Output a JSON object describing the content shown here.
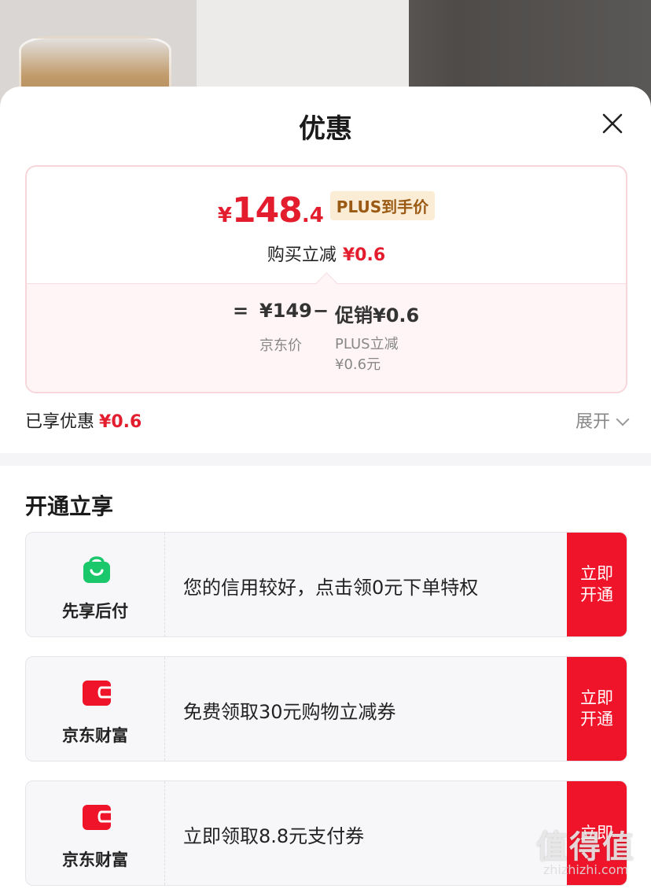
{
  "sheet": {
    "title": "优惠"
  },
  "price_card": {
    "currency": "¥",
    "price_int": "148",
    "price_dec": ".4",
    "plus_tag": "PLUS到手价",
    "save_label": "购买立减",
    "save_value": "¥0.6",
    "formula": {
      "eq": "=",
      "jd_price": "¥149",
      "minus": "−",
      "promo": "促销¥0.6",
      "jd_caption": "京东价",
      "plus_caption_1": "PLUS立减",
      "plus_caption_2": "¥0.6元"
    }
  },
  "enjoyed": {
    "label": "已享优惠",
    "value": "¥0.6",
    "expand_label": "展开"
  },
  "section": {
    "title": "开通立享"
  },
  "offers": [
    {
      "brand": "先享后付",
      "icon": "shopping-bag-icon",
      "icon_color": "#1bc76b",
      "desc": "您的信用较好，点击领0元下单特权",
      "btn": "立即开通"
    },
    {
      "brand": "京东财富",
      "icon": "wallet-icon",
      "icon_color": "#f0142a",
      "desc": "免费领取30元购物立减券",
      "btn": "立即开通"
    },
    {
      "brand": "京东财富",
      "icon": "wallet-icon",
      "icon_color": "#f0142a",
      "desc": "立即领取8.8元支付券",
      "btn": "立即"
    }
  ],
  "watermark": {
    "main": "值得值",
    "sub": "zhizhizhi.com"
  },
  "colors": {
    "accent_red": "#e31d2e",
    "button_red": "#f0142a",
    "plus_gold": "#9b5a14"
  }
}
